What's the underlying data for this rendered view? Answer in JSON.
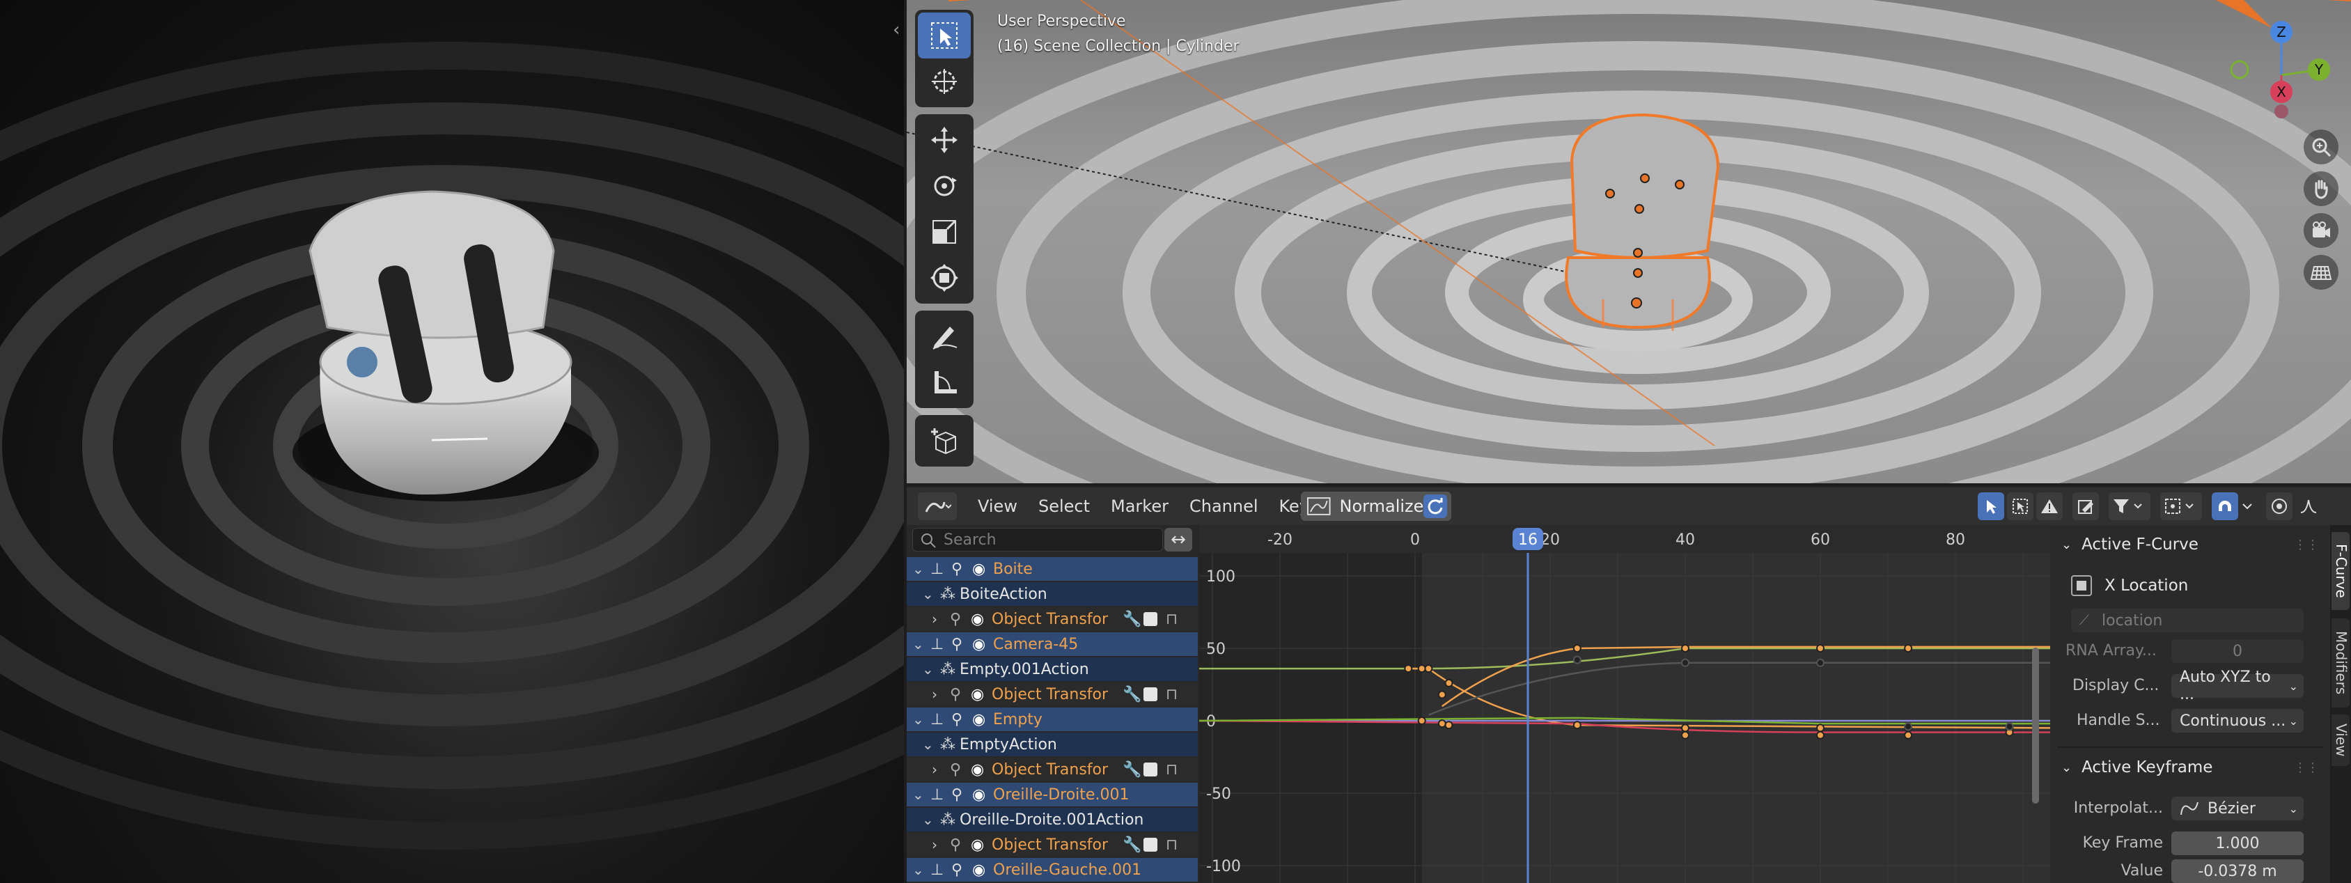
{
  "viewport": {
    "title_line1": "User Perspective",
    "title_line2": "(16) Scene Collection | Cylinder",
    "gizmo": {
      "z": "Z",
      "y": "Y",
      "x": "X"
    },
    "tools": [
      "select-box-icon",
      "cursor-icon",
      "move-icon",
      "rotate-icon",
      "scale-icon",
      "transform-icon",
      "annotate-icon",
      "measure-icon",
      "add-cube-icon"
    ],
    "nav": [
      "zoom-icon",
      "hand-pan-icon",
      "camera-icon",
      "grid-icon"
    ]
  },
  "graph_editor": {
    "menus": [
      "View",
      "Select",
      "Marker",
      "Channel",
      "Key"
    ],
    "normalize_label": "Normalize",
    "search_placeholder": "Search",
    "swap_icon": "↔",
    "current_frame": "16",
    "frame_ticks": [
      "-20",
      "0",
      "20",
      "40",
      "60",
      "80"
    ],
    "value_ticks": [
      "100",
      "50",
      "0",
      "-50",
      "-100"
    ],
    "channels": [
      {
        "label": "Boite",
        "kind": "obj"
      },
      {
        "label": "BoiteAction",
        "kind": "act"
      },
      {
        "label": "Object Transfor",
        "kind": "grp"
      },
      {
        "label": "Camera-45",
        "kind": "obj"
      },
      {
        "label": "Empty.001Action",
        "kind": "act"
      },
      {
        "label": "Object Transfor",
        "kind": "grp"
      },
      {
        "label": "Empty",
        "kind": "obj"
      },
      {
        "label": "EmptyAction",
        "kind": "act"
      },
      {
        "label": "Object Transfor",
        "kind": "grp"
      },
      {
        "label": "Oreille-Droite.001",
        "kind": "obj"
      },
      {
        "label": "Oreille-Droite.001Action",
        "kind": "act"
      },
      {
        "label": "Object Transfor",
        "kind": "grp"
      },
      {
        "label": "Oreille-Gauche.001",
        "kind": "obj"
      }
    ]
  },
  "sidebar": {
    "active_fcurve_title": "Active F-Curve",
    "fcurve_name": "X Location",
    "data_path": "location",
    "rna_array_label": "RNA Array...",
    "rna_array_value": "0",
    "display_color_label": "Display C...",
    "display_color_value": "Auto XYZ to ...",
    "handle_smoothing_label": "Handle S...",
    "handle_smoothing_value": "Continuous ...",
    "active_keyframe_title": "Active Keyframe",
    "interpolation_label": "Interpolat...",
    "interpolation_value": "Bézier",
    "key_frame_label": "Key Frame",
    "key_frame_value": "1.000",
    "value_label": "Value",
    "value_value": "-0.0378 m",
    "tabs": [
      "F-Curve",
      "Modifiers",
      "View"
    ]
  }
}
